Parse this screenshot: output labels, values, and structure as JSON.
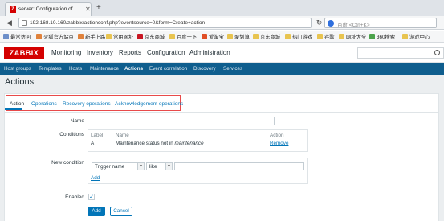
{
  "browser": {
    "tab_title": "server: Configuration of ...",
    "tab_favicon": "Z",
    "url": "192.168.10.160/zabbix/actionconf.php?eventsource=0&form=Create+action",
    "search_placeholder": "百度 <Ctrl+K>",
    "bookmarks": [
      "最常访问",
      "火狐官方站点",
      "新手上路",
      "常用网址",
      "京东商城",
      "百度一下",
      "爱淘宝",
      "聚划算",
      "京东商城",
      "热门游戏",
      "谷歌",
      "网址大全",
      "360搜索",
      "游戏中心"
    ]
  },
  "header": {
    "logo": "ZABBIX",
    "menu": [
      "Monitoring",
      "Inventory",
      "Reports",
      "Configuration",
      "Administration"
    ],
    "active_menu": "Configuration"
  },
  "submenu": {
    "items": [
      "Host groups",
      "Templates",
      "Hosts",
      "Maintenance",
      "Actions",
      "Event correlation",
      "Discovery",
      "Services"
    ],
    "active": "Actions"
  },
  "page": {
    "title": "Actions"
  },
  "form_tabs": [
    "Action",
    "Operations",
    "Recovery operations",
    "Acknowledgement operations"
  ],
  "form": {
    "name_label": "Name",
    "name_value": "",
    "conditions_label": "Conditions",
    "conditions_headers": {
      "label": "Label",
      "name": "Name",
      "action": "Action"
    },
    "conditions_rows": [
      {
        "label": "A",
        "name": "Maintenance status not in maintenance",
        "action": "Remove"
      }
    ],
    "new_condition_label": "New condition",
    "new_condition_type": "Trigger name",
    "new_condition_operator": "like",
    "new_condition_value": "",
    "new_condition_add": "Add",
    "enabled_label": "Enabled",
    "enabled": true,
    "enabled_mark": "✓"
  },
  "buttons": {
    "add": "Add",
    "cancel": "Cancel"
  }
}
